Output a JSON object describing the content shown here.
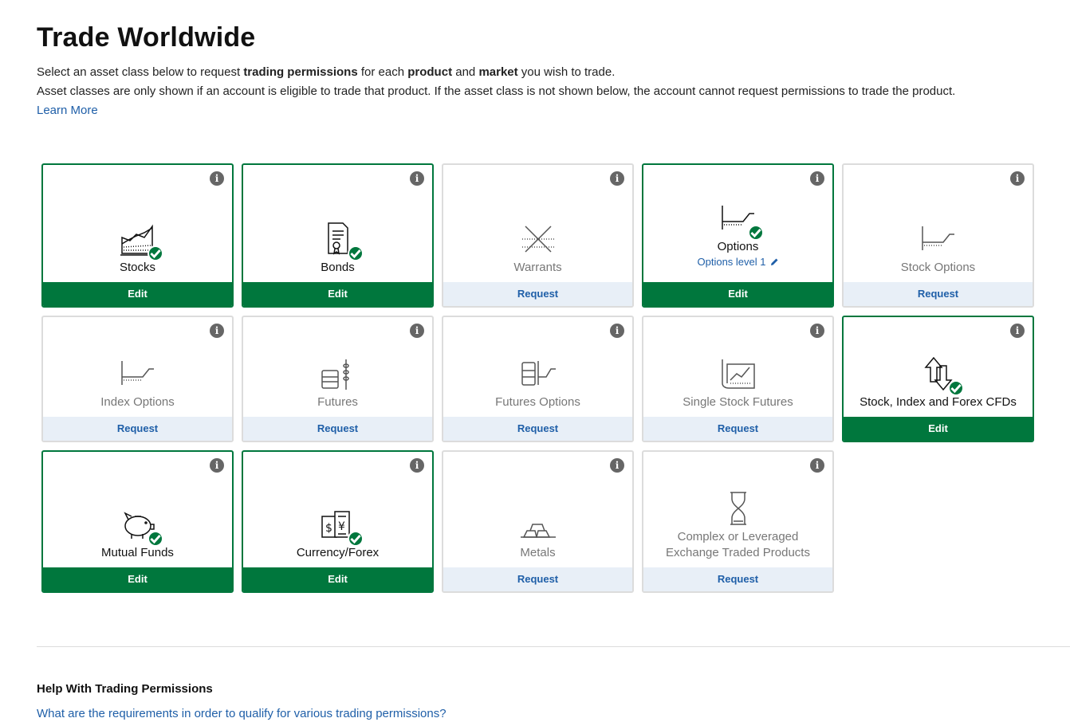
{
  "title": "Trade Worldwide",
  "intro": {
    "line1_pre": "Select an asset class below to request ",
    "line1_b1": "trading permissions",
    "line1_mid1": " for each ",
    "line1_b2": "product",
    "line1_mid2": " and ",
    "line1_b3": "market",
    "line1_post": " you wish to trade.",
    "line2": "Asset classes are only shown if an account is eligible to trade that product. If the asset class is not shown below, the account cannot request permissions to trade the product.",
    "learn_more": "Learn More"
  },
  "info_glyph": "i",
  "colors": {
    "active": "#00773d",
    "link": "#1f5fa8",
    "request_bg": "#e8eff7"
  },
  "cards": [
    {
      "name": "Stocks",
      "action": "Edit",
      "active": true,
      "icon": "stocks-icon"
    },
    {
      "name": "Bonds",
      "action": "Edit",
      "active": true,
      "icon": "bonds-icon"
    },
    {
      "name": "Warrants",
      "action": "Request",
      "active": false,
      "icon": "warrants-icon"
    },
    {
      "name": "Options",
      "action": "Edit",
      "active": true,
      "icon": "options-icon",
      "sub": "Options level 1"
    },
    {
      "name": "Stock Options",
      "action": "Request",
      "active": false,
      "icon": "stock-options-icon"
    },
    {
      "name": "Index Options",
      "action": "Request",
      "active": false,
      "icon": "index-options-icon"
    },
    {
      "name": "Futures",
      "action": "Request",
      "active": false,
      "icon": "futures-icon"
    },
    {
      "name": "Futures Options",
      "action": "Request",
      "active": false,
      "icon": "futures-options-icon"
    },
    {
      "name": "Single Stock Futures",
      "action": "Request",
      "active": false,
      "icon": "single-stock-futures-icon"
    },
    {
      "name": "Stock, Index and Forex CFDs",
      "action": "Edit",
      "active": true,
      "icon": "cfd-icon"
    },
    {
      "name": "Mutual Funds",
      "action": "Edit",
      "active": true,
      "icon": "piggy-bank-icon"
    },
    {
      "name": "Currency/Forex",
      "action": "Edit",
      "active": true,
      "icon": "currency-icon"
    },
    {
      "name": "Metals",
      "action": "Request",
      "active": false,
      "icon": "metals-icon"
    },
    {
      "name": "Complex or Leveraged Exchange Traded Products",
      "action": "Request",
      "active": false,
      "icon": "hourglass-icon"
    }
  ],
  "help": {
    "title": "Help With Trading Permissions",
    "link": "What are the requirements in order to qualify for various trading permissions?"
  }
}
